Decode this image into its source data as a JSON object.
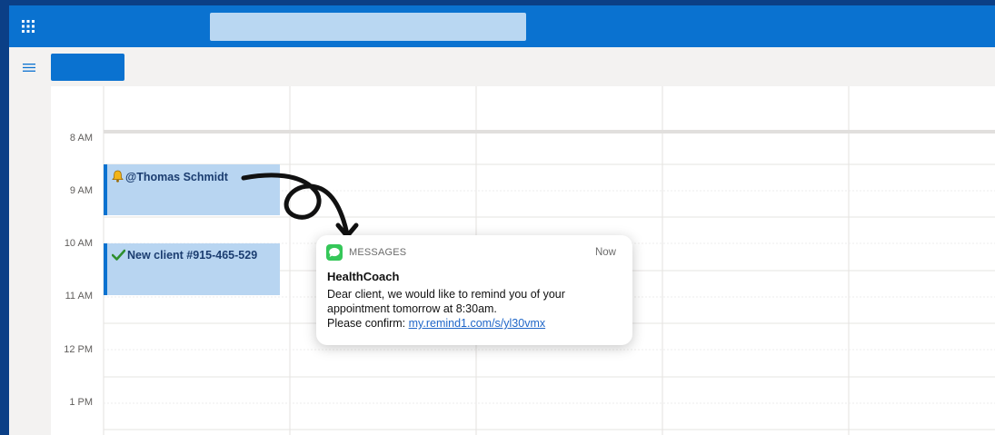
{
  "calendar": {
    "hours": [
      "8 AM",
      "9 AM",
      "10 AM",
      "11 AM",
      "12 PM",
      "1 PM"
    ]
  },
  "events": [
    {
      "icon": "bell-icon",
      "title": "@Thomas Schmidt"
    },
    {
      "icon": "checkmark-icon",
      "title": "New client #915-465-529"
    }
  ],
  "notification": {
    "app": "MESSAGES",
    "time": "Now",
    "sender": "HealthCoach",
    "line1": "Dear client, we would like to remind you of your",
    "line2": "appointment tomorrow at 8:30am.",
    "confirm_prefix": "Please confirm: ",
    "link": "my.remind1.com/s/yl30vmx"
  },
  "colors": {
    "accent": "#0a72d0",
    "event_fill": "#b8d5f1",
    "messages_green": "#35c759"
  }
}
